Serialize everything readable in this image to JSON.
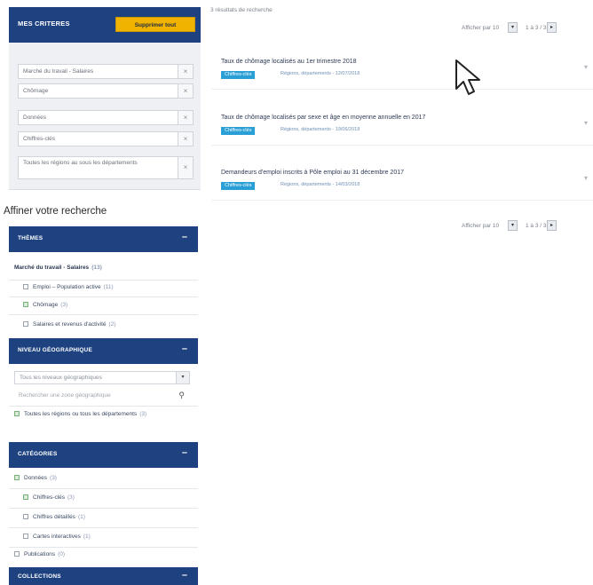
{
  "criteria": {
    "title": "MES CRITERES",
    "clear_label": "Supprimer tout",
    "items": [
      "Marché du travail - Salaires",
      "Chômage",
      "Données",
      "Chiffres-clés",
      "Toutes les régions au sous les départements"
    ]
  },
  "refine_title": "Affiner votre recherche",
  "themes": {
    "heading": "THÈMES",
    "toggle": "–",
    "parent": {
      "label": "Marché du travail - Salaires",
      "count": "(13)"
    },
    "items": [
      {
        "label": "Emploi – Population active",
        "count": "(11)"
      },
      {
        "label": "Chômage",
        "count": "(3)"
      },
      {
        "label": "Salaires et revenus d'activité",
        "count": "(2)"
      }
    ]
  },
  "geo": {
    "heading": "NIVEAU GÉOGRAPHIQUE",
    "toggle": "–",
    "select_value": "Tous les niveaux géographiques",
    "search_placeholder": "Rechercher une zone géographique",
    "item": {
      "label": "Toutes les régions ou tous les départements",
      "count": "(3)"
    }
  },
  "categories": {
    "heading": "CATÉGORIES",
    "toggle": "–",
    "items": [
      {
        "label": "Données",
        "count": "(3)"
      },
      {
        "label": "Chiffres-clés",
        "count": "(3)"
      },
      {
        "label": "Chiffres détaillés",
        "count": "(1)"
      },
      {
        "label": "Cartes interactives",
        "count": "(1)"
      },
      {
        "label": "Publications",
        "count": "(0)"
      }
    ]
  },
  "collections": {
    "heading": "COLLECTIONS",
    "toggle": "–"
  },
  "results": {
    "count_text": "3 résultats de recherche",
    "pager": {
      "label": "Afficher par 10",
      "select": "▾",
      "pages": "1 à 3 / 3",
      "next": "▸"
    },
    "items": [
      {
        "title": "Taux de chômage localisés au 1er trimestre 2018",
        "badge": "Chiffres-clés",
        "meta": "Régions, départements - 12/07/2018"
      },
      {
        "title": "Taux de chômage localisés par sexe et âge en moyenne annuelle en 2017",
        "badge": "Chiffres-clés",
        "meta": "Régions, départements - 19/06/2018"
      },
      {
        "title": "Demandeurs d'emploi inscrits à Pôle emploi au 31 décembre 2017",
        "badge": "Chiffres-clés",
        "meta": "Régions, départements - 14/03/2018"
      }
    ]
  },
  "icons": {
    "remove": "×",
    "dropdown": "▾",
    "search": "⚲",
    "expand": "▾"
  }
}
